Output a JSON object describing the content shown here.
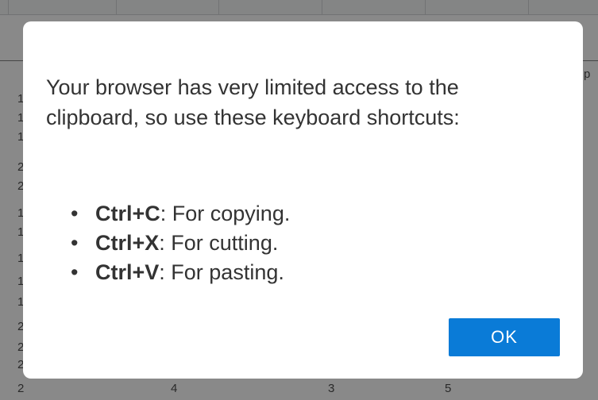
{
  "background_sheet": {
    "corner_header_text": "p",
    "row_digits": [
      "1",
      "1",
      "1",
      "2",
      "2",
      "1",
      "1",
      "1",
      "1",
      "1",
      "2",
      "2",
      "2"
    ],
    "bottom_row_cells": [
      "2",
      "4",
      "3",
      "5"
    ]
  },
  "dialog": {
    "message": "Your browser has very limited access to the clipboard, so use these keyboard shortcuts:",
    "shortcuts": [
      {
        "key": "Ctrl+C",
        "description": ": For copying."
      },
      {
        "key": "Ctrl+X",
        "description": ": For cutting."
      },
      {
        "key": "Ctrl+V",
        "description": ": For pasting."
      }
    ],
    "ok_label": "OK",
    "ok_color": "#0a7bd7"
  }
}
